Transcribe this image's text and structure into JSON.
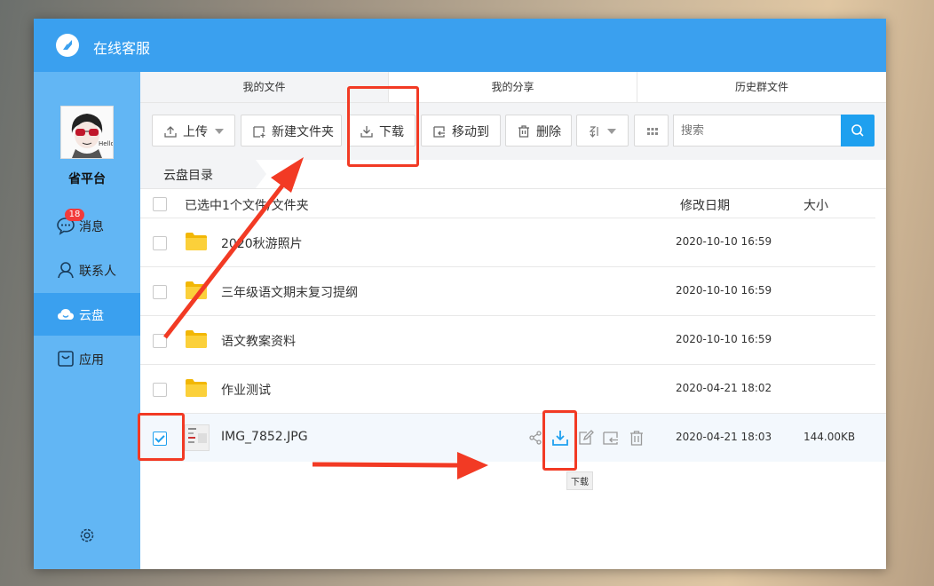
{
  "app": {
    "title": "在线客服"
  },
  "profile": {
    "name": "省平台"
  },
  "nav": {
    "items": [
      {
        "label": "消息",
        "icon": "chat-icon",
        "badge": "18"
      },
      {
        "label": "联系人",
        "icon": "contacts-icon"
      },
      {
        "label": "云盘",
        "icon": "cloud-icon",
        "active": true
      },
      {
        "label": "应用",
        "icon": "apps-icon"
      }
    ],
    "settings_icon": "gear-icon"
  },
  "tabs": [
    {
      "label": "我的文件",
      "active": true
    },
    {
      "label": "我的分享"
    },
    {
      "label": "历史群文件"
    }
  ],
  "toolbar": {
    "upload": "上传",
    "new_folder": "新建文件夹",
    "download": "下载",
    "move_to": "移动到",
    "delete": "删除",
    "search_placeholder": "搜索"
  },
  "breadcrumb": {
    "root": "云盘目录"
  },
  "list": {
    "header": {
      "selection": "已选中1个文件/文件夹",
      "date": "修改日期",
      "size": "大小"
    },
    "rows": [
      {
        "name": "2020秋游照片",
        "type": "folder",
        "date": "2020-10-10 16:59",
        "size": ""
      },
      {
        "name": "三年级语文期末复习提纲",
        "type": "folder",
        "date": "2020-10-10 16:59",
        "size": ""
      },
      {
        "name": "语文教案资料",
        "type": "folder",
        "date": "2020-10-10 16:59",
        "size": ""
      },
      {
        "name": "作业测试",
        "type": "folder",
        "date": "2020-04-21 18:02",
        "size": ""
      },
      {
        "name": "IMG_7852.JPG",
        "type": "image",
        "date": "2020-04-21 18:03",
        "size": "144.00KB",
        "selected": true
      }
    ]
  },
  "tooltip": {
    "text": "下载"
  },
  "colors": {
    "accent": "#3aa0ef",
    "sidebar": "#62b6f4",
    "annotation": "#f23a24",
    "folder": "#f7c21a"
  }
}
